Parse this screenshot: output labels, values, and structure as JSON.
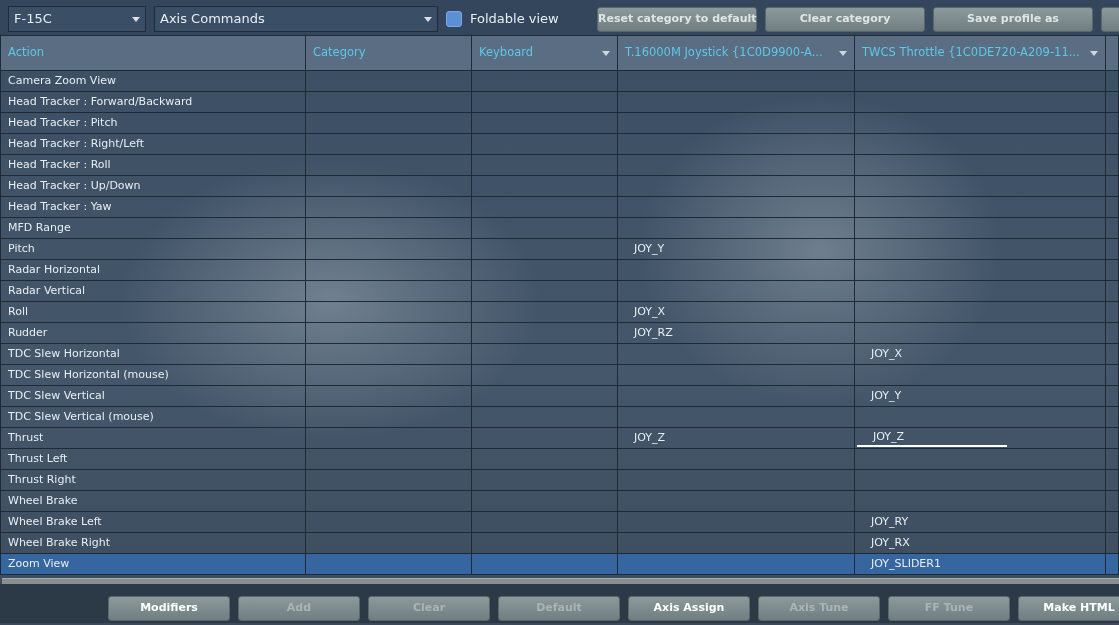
{
  "toolbar": {
    "aircraft": "F-15C",
    "category": "Axis Commands",
    "foldable_view": {
      "label": "Foldable view",
      "checked": false
    },
    "buttons": [
      "Reset category to default",
      "Clear category",
      "Save profile as"
    ]
  },
  "table": {
    "columns": [
      {
        "label": "Action",
        "dropdown": false
      },
      {
        "label": "Category",
        "dropdown": false
      },
      {
        "label": "Keyboard",
        "dropdown": true
      },
      {
        "label": "T.16000M Joystick {1C0D9900-A...",
        "dropdown": true
      },
      {
        "label": "TWCS Throttle {1C0DE720-A209-11...",
        "dropdown": true
      }
    ],
    "rows": [
      {
        "action": "Camera Zoom View",
        "joystick": "",
        "throttle": "",
        "selected": false,
        "editing": false
      },
      {
        "action": "Head Tracker : Forward/Backward",
        "joystick": "",
        "throttle": "",
        "selected": false,
        "editing": false
      },
      {
        "action": "Head Tracker : Pitch",
        "joystick": "",
        "throttle": "",
        "selected": false,
        "editing": false
      },
      {
        "action": "Head Tracker : Right/Left",
        "joystick": "",
        "throttle": "",
        "selected": false,
        "editing": false
      },
      {
        "action": "Head Tracker : Roll",
        "joystick": "",
        "throttle": "",
        "selected": false,
        "editing": false
      },
      {
        "action": "Head Tracker : Up/Down",
        "joystick": "",
        "throttle": "",
        "selected": false,
        "editing": false
      },
      {
        "action": "Head Tracker : Yaw",
        "joystick": "",
        "throttle": "",
        "selected": false,
        "editing": false
      },
      {
        "action": "MFD Range",
        "joystick": "",
        "throttle": "",
        "selected": false,
        "editing": false
      },
      {
        "action": "Pitch",
        "joystick": "JOY_Y",
        "throttle": "",
        "selected": false,
        "editing": false
      },
      {
        "action": "Radar Horizontal",
        "joystick": "",
        "throttle": "",
        "selected": false,
        "editing": false
      },
      {
        "action": "Radar Vertical",
        "joystick": "",
        "throttle": "",
        "selected": false,
        "editing": false
      },
      {
        "action": "Roll",
        "joystick": "JOY_X",
        "throttle": "",
        "selected": false,
        "editing": false
      },
      {
        "action": "Rudder",
        "joystick": "JOY_RZ",
        "throttle": "",
        "selected": false,
        "editing": false
      },
      {
        "action": "TDC Slew Horizontal",
        "joystick": "",
        "throttle": "JOY_X",
        "selected": false,
        "editing": false
      },
      {
        "action": "TDC Slew Horizontal (mouse)",
        "joystick": "",
        "throttle": "",
        "selected": false,
        "editing": false
      },
      {
        "action": "TDC Slew Vertical",
        "joystick": "",
        "throttle": "JOY_Y",
        "selected": false,
        "editing": false
      },
      {
        "action": "TDC Slew Vertical (mouse)",
        "joystick": "",
        "throttle": "",
        "selected": false,
        "editing": false
      },
      {
        "action": "Thrust",
        "joystick": "JOY_Z",
        "throttle": "JOY_Z",
        "selected": false,
        "editing": true
      },
      {
        "action": "Thrust Left",
        "joystick": "",
        "throttle": "",
        "selected": false,
        "editing": false
      },
      {
        "action": "Thrust Right",
        "joystick": "",
        "throttle": "",
        "selected": false,
        "editing": false
      },
      {
        "action": "Wheel Brake",
        "joystick": "",
        "throttle": "",
        "selected": false,
        "editing": false
      },
      {
        "action": "Wheel Brake Left",
        "joystick": "",
        "throttle": "JOY_RY",
        "selected": false,
        "editing": false
      },
      {
        "action": "Wheel Brake Right",
        "joystick": "",
        "throttle": "JOY_RX",
        "selected": false,
        "editing": false
      },
      {
        "action": "Zoom View",
        "joystick": "",
        "throttle": "JOY_SLIDER1",
        "selected": true,
        "editing": false
      }
    ]
  },
  "bottom_buttons": [
    {
      "label": "Modifiers",
      "disabled": false
    },
    {
      "label": "Add",
      "disabled": true
    },
    {
      "label": "Clear",
      "disabled": true
    },
    {
      "label": "Default",
      "disabled": true
    },
    {
      "label": "Axis Assign",
      "disabled": false
    },
    {
      "label": "Axis Tune",
      "disabled": true
    },
    {
      "label": "FF Tune",
      "disabled": true
    },
    {
      "label": "Make HTML",
      "disabled": false
    }
  ]
}
